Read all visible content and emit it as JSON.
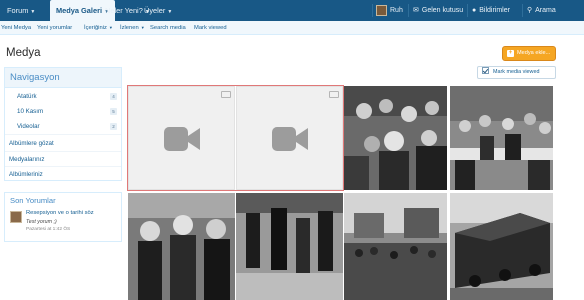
{
  "topnav": {
    "tabs": [
      {
        "label": "Forum",
        "active": false
      },
      {
        "label": "Medya Galeri",
        "active": true
      },
      {
        "label": "Neler Yeni?",
        "active": false
      },
      {
        "label": "Üyeler",
        "active": false
      }
    ],
    "user": "Ruh",
    "inbox": "Gelen kutusu",
    "alerts": "Bildirimler",
    "search": "Arama"
  },
  "subnav": {
    "links": [
      "Yeni Medya",
      "Yeni yorumlar",
      "İçeriğiniz",
      "İzlenen",
      "Search media",
      "Mark viewed"
    ]
  },
  "page": {
    "title": "Medya",
    "add_media": "Medya ekle...",
    "mark_viewed": "Mark media viewed"
  },
  "sidebar": {
    "heading": "Navigasyon",
    "categories": [
      {
        "label": "Atatürk",
        "count": "4"
      },
      {
        "label": "10 Kasım",
        "count": "5"
      },
      {
        "label": "Videolar",
        "count": "2"
      }
    ],
    "links": [
      "Albümlere gözat",
      "Medyalarınız",
      "Albümleriniz"
    ]
  },
  "recent_comments": {
    "heading": "Son Yorumlar",
    "title": "Resepsiyon ve o tarihi söz",
    "text": "Test yorum ;)",
    "date": "Pazartesi at 1:42 ÖS"
  },
  "colors": {
    "nav_bar": "#185886",
    "accent": "#f5a623",
    "link": "#176093",
    "highlight": "#e07878"
  },
  "media": {
    "videos": [
      {
        "icon": "video-camera-icon"
      },
      {
        "icon": "video-camera-icon"
      }
    ],
    "photos": [
      {
        "kind": "black-and-white-photo",
        "subject": "crowd-portrait"
      },
      {
        "kind": "black-and-white-photo",
        "subject": "banquet"
      },
      {
        "kind": "black-and-white-photo",
        "subject": "children"
      },
      {
        "kind": "black-and-white-photo",
        "subject": "street-procession"
      },
      {
        "kind": "black-and-white-photo",
        "subject": "city-crowd"
      },
      {
        "kind": "black-and-white-photo",
        "subject": "train-station"
      }
    ]
  }
}
